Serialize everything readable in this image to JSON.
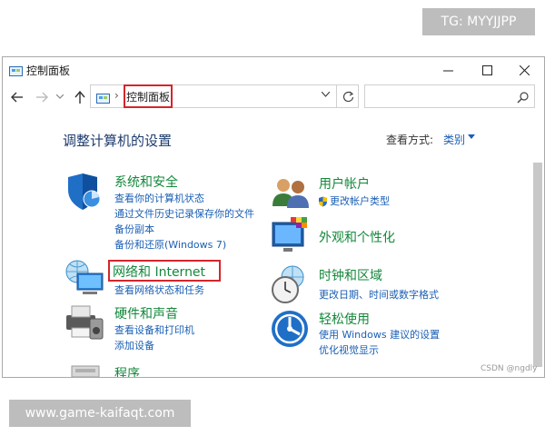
{
  "watermark_tg": "TG: MYYJJPP",
  "watermark_site": "www.game-kaifaqt.com",
  "window": {
    "title": "控制面板",
    "address_crumb": "控制面板",
    "search_placeholder": ""
  },
  "heading": "调整计算机的设置",
  "view_by": {
    "label": "查看方式:",
    "value": "类别"
  },
  "categories": [
    {
      "title": "系统和安全",
      "links": [
        "查看你的计算机状态",
        "通过文件历史记录保存你的文件",
        "备份副本",
        "备份和还原(Windows 7)"
      ]
    },
    {
      "title": "网络和 Internet",
      "links": [
        "查看网络状态和任务"
      ]
    },
    {
      "title": "硬件和声音",
      "links": [
        "查看设备和打印机",
        "添加设备"
      ]
    },
    {
      "title": "程序",
      "links": []
    },
    {
      "title": "用户帐户",
      "links": [
        "更改帐户类型"
      ]
    },
    {
      "title": "外观和个性化",
      "links": []
    },
    {
      "title": "时钟和区域",
      "links": [
        "更改日期、时间或数字格式"
      ]
    },
    {
      "title": "轻松使用",
      "links": [
        "使用 Windows 建议的设置",
        "优化视觉显示"
      ]
    }
  ],
  "csdn_mark": "CSDN @ngdly",
  "colors": {
    "category_green": "#13883b",
    "link_blue": "#1a5fb4",
    "highlight_red": "#d3262c"
  }
}
